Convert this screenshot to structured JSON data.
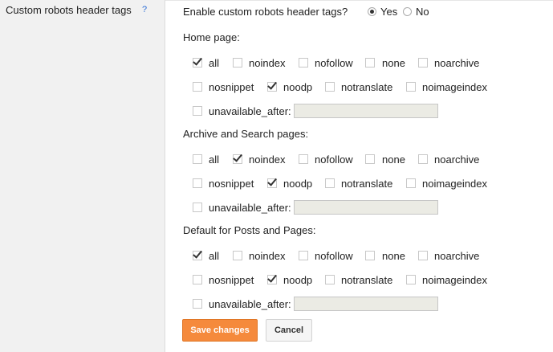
{
  "setting": {
    "title": "Custom robots header tags",
    "help": "?"
  },
  "enable": {
    "question": "Enable custom robots header tags?",
    "yes": "Yes",
    "no": "No",
    "selected": "Yes"
  },
  "sections": [
    {
      "title": "Home page:",
      "options": {
        "all": true,
        "noindex": false,
        "nofollow": false,
        "none": false,
        "noarchive": false,
        "nosnippet": false,
        "noodp": true,
        "notranslate": false,
        "noimageindex": false,
        "unavailable_after": false
      },
      "unavailable_after_value": ""
    },
    {
      "title": "Archive and Search pages:",
      "options": {
        "all": false,
        "noindex": true,
        "nofollow": false,
        "none": false,
        "noarchive": false,
        "nosnippet": false,
        "noodp": true,
        "notranslate": false,
        "noimageindex": false,
        "unavailable_after": false
      },
      "unavailable_after_value": ""
    },
    {
      "title": "Default for Posts and Pages:",
      "options": {
        "all": true,
        "noindex": false,
        "nofollow": false,
        "none": false,
        "noarchive": false,
        "nosnippet": false,
        "noodp": true,
        "notranslate": false,
        "noimageindex": false,
        "unavailable_after": false
      },
      "unavailable_after_value": ""
    }
  ],
  "labels": {
    "all": "all",
    "noindex": "noindex",
    "nofollow": "nofollow",
    "none": "none",
    "noarchive": "noarchive",
    "nosnippet": "nosnippet",
    "noodp": "noodp",
    "notranslate": "notranslate",
    "noimageindex": "noimageindex",
    "unavailable_after": "unavailable_after:"
  },
  "buttons": {
    "save": "Save changes",
    "cancel": "Cancel"
  },
  "colors": {
    "save_button": "#f58a3c",
    "left_panel": "#f1f1f1",
    "help_link": "#2f6fd6"
  }
}
